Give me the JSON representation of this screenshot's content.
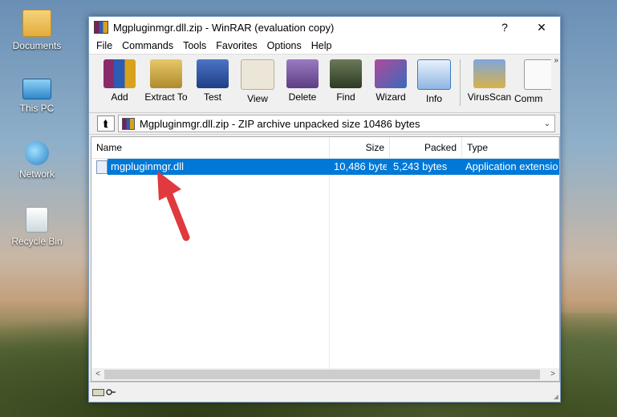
{
  "desktop": {
    "icons": [
      {
        "label": "Documents",
        "icon": "folder-icon"
      },
      {
        "label": "This PC",
        "icon": "computer-icon"
      },
      {
        "label": "Network",
        "icon": "network-icon"
      },
      {
        "label": "Recycle Bin",
        "icon": "recycle-bin-icon"
      }
    ]
  },
  "window": {
    "title": "Mgpluginmgr.dll.zip - WinRAR (evaluation copy)",
    "help_label": "?",
    "close_label": "✕"
  },
  "menu": [
    "File",
    "Commands",
    "Tools",
    "Favorites",
    "Options",
    "Help"
  ],
  "toolbar": {
    "buttons": [
      {
        "label": "Add",
        "icon": "add-archive-icon",
        "color": "#8b2a6b"
      },
      {
        "label": "Extract To",
        "icon": "extract-icon",
        "color": "#c9a441"
      },
      {
        "label": "Test",
        "icon": "test-icon",
        "color": "#2f56a8"
      },
      {
        "label": "View",
        "icon": "view-glasses-icon",
        "color": "#e8e0d0"
      },
      {
        "label": "Delete",
        "icon": "delete-icon",
        "color": "#7d5aa0"
      },
      {
        "label": "Find",
        "icon": "find-binoculars-icon",
        "color": "#4a5a3a"
      },
      {
        "label": "Wizard",
        "icon": "wizard-icon",
        "color": "#9b3a8a"
      },
      {
        "label": "Info",
        "icon": "info-icon",
        "color": "#3a7ac4"
      },
      {
        "label": "VirusScan",
        "icon": "virusscan-icon",
        "color": "#3d6fb8"
      },
      {
        "label": "Comm",
        "icon": "comment-icon",
        "color": "#f5f5f5"
      }
    ],
    "more_label": "»"
  },
  "address": {
    "up_label": "⮬",
    "text": "Mgpluginmgr.dll.zip - ZIP archive unpacked size 10486 bytes",
    "dropdown": "⌄"
  },
  "list": {
    "columns": [
      "Name",
      "Size",
      "Packed",
      "Type"
    ],
    "sort_indicator": "⌃",
    "rows": [
      {
        "name": "mgpluginmgr.dll",
        "size": "10,486 byte",
        "packed": "5,243 bytes",
        "type": "Application extensio"
      }
    ]
  },
  "scroll": {
    "left": "<",
    "right": ">"
  },
  "colors": {
    "selection": "#0078d7",
    "annotation_arrow": "#e0393e"
  }
}
